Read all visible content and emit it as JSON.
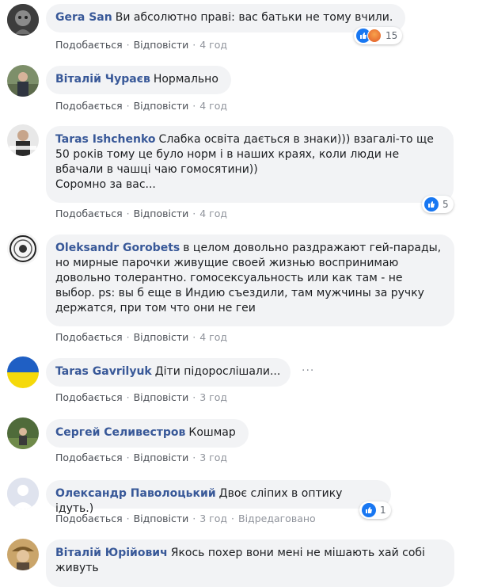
{
  "actions": {
    "like": "Подобається",
    "reply": "Відповісти",
    "edited": "Відредаговано"
  },
  "more_dots": "···",
  "comments": [
    {
      "author": "Gera San",
      "text": "Ви абсолютно праві: вас батьки не тому вчили.",
      "time": "4 год",
      "reactions": "15"
    },
    {
      "author": "Віталій Чураєв",
      "text": "Нормально",
      "time": "4 год"
    },
    {
      "author": "Taras Ishchenko",
      "text": "Слабка освіта дається в знаки))) взагалі-то ще 50 років тому це було норм і в наших краях, коли люди не вбачали в чашці чаю гомосятини))",
      "text2": "Соромно за вас...",
      "time": "4 год",
      "reactions": "5"
    },
    {
      "author": "Oleksandr Gorobets",
      "text": "в целом довольно раздражают гей-парады, но мирные парочки живущие своей жизнью воспринимаю довольно толерантно. гомосексуальность или как там - не выбор. ps: вы б еще в Индию съездили, там мужчины за ручку держатся, при том что они не геи",
      "time": "4 год"
    },
    {
      "author": "Taras Gavrilyuk",
      "text": "Діти підорослішали...",
      "time": "3 год"
    },
    {
      "author": "Сергей Селивестров",
      "text": "Кошмар",
      "time": "3 год"
    },
    {
      "author": "Олександр Паволоцький",
      "text": "Двоє сліпих в оптику ідуть.)",
      "time": "3 год",
      "reactions": "1"
    },
    {
      "author": "Віталій Юрійович",
      "text": "Якось похер вони мені не мішають хай собі живуть"
    }
  ]
}
